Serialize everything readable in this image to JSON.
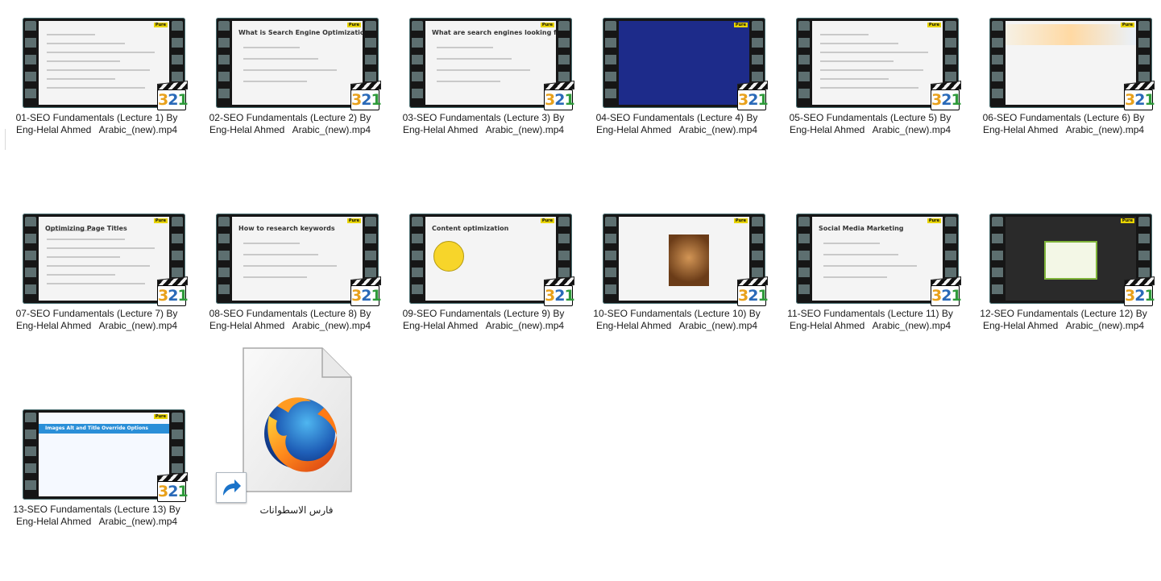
{
  "files": [
    {
      "line1": "01-SEO Fundamentals (Lecture 1) By",
      "line2": "Eng-Helal Ahmed   Arabic_(new).mp4",
      "preview": "web"
    },
    {
      "line1": "02-SEO Fundamentals (Lecture 2) By",
      "line2": "Eng-Helal Ahmed   Arabic_(new).mp4",
      "preview": "slide",
      "slide_title": "What is Search Engine Optimization"
    },
    {
      "line1": "03-SEO Fundamentals (Lecture 3) By",
      "line2": "Eng-Helal Ahmed   Arabic_(new).mp4",
      "preview": "slide",
      "slide_title": "What are search engines looking for"
    },
    {
      "line1": "04-SEO Fundamentals (Lecture 4) By",
      "line2": "Eng-Helal Ahmed   Arabic_(new).mp4",
      "preview": "dark"
    },
    {
      "line1": "05-SEO Fundamentals (Lecture 5) By",
      "line2": "Eng-Helal Ahmed   Arabic_(new).mp4",
      "preview": "web"
    },
    {
      "line1": "06-SEO Fundamentals (Lecture 6) By",
      "line2": "Eng-Helal Ahmed   Arabic_(new).mp4",
      "preview": "banner"
    },
    {
      "line1": "07-SEO Fundamentals (Lecture 7) By",
      "line2": "Eng-Helal Ahmed   Arabic_(new).mp4",
      "preview": "web",
      "slide_title": "Optimizing Page Titles"
    },
    {
      "line1": "08-SEO Fundamentals (Lecture 8) By",
      "line2": "Eng-Helal Ahmed   Arabic_(new).mp4",
      "preview": "slide",
      "slide_title": "How to research keywords"
    },
    {
      "line1": "09-SEO Fundamentals (Lecture 9) By",
      "line2": "Eng-Helal Ahmed   Arabic_(new).mp4",
      "preview": "smile",
      "slide_title": "Content optimization"
    },
    {
      "line1": "10-SEO Fundamentals (Lecture 10) By",
      "line2": "Eng-Helal Ahmed   Arabic_(new).mp4",
      "preview": "cat"
    },
    {
      "line1": "11-SEO Fundamentals (Lecture 11) By",
      "line2": "Eng-Helal Ahmed   Arabic_(new).mp4",
      "preview": "slide",
      "slide_title": "Social Media Marketing"
    },
    {
      "line1": "12-SEO Fundamentals (Lecture 12) By",
      "line2": "Eng-Helal Ahmed   Arabic_(new).mp4",
      "preview": "darkpop"
    },
    {
      "line1": "13-SEO Fundamentals (Lecture 13) By",
      "line2": "Eng-Helal Ahmed   Arabic_(new).mp4",
      "preview": "blue",
      "slide_title": "Images Alt and Title Override Options"
    }
  ],
  "shortcut": {
    "label": "فارس الاسطوانات",
    "icon": "firefox-icon",
    "overlay_icon": "shortcut-arrow-icon"
  },
  "badge_text": "321",
  "pure_label": "Pure"
}
